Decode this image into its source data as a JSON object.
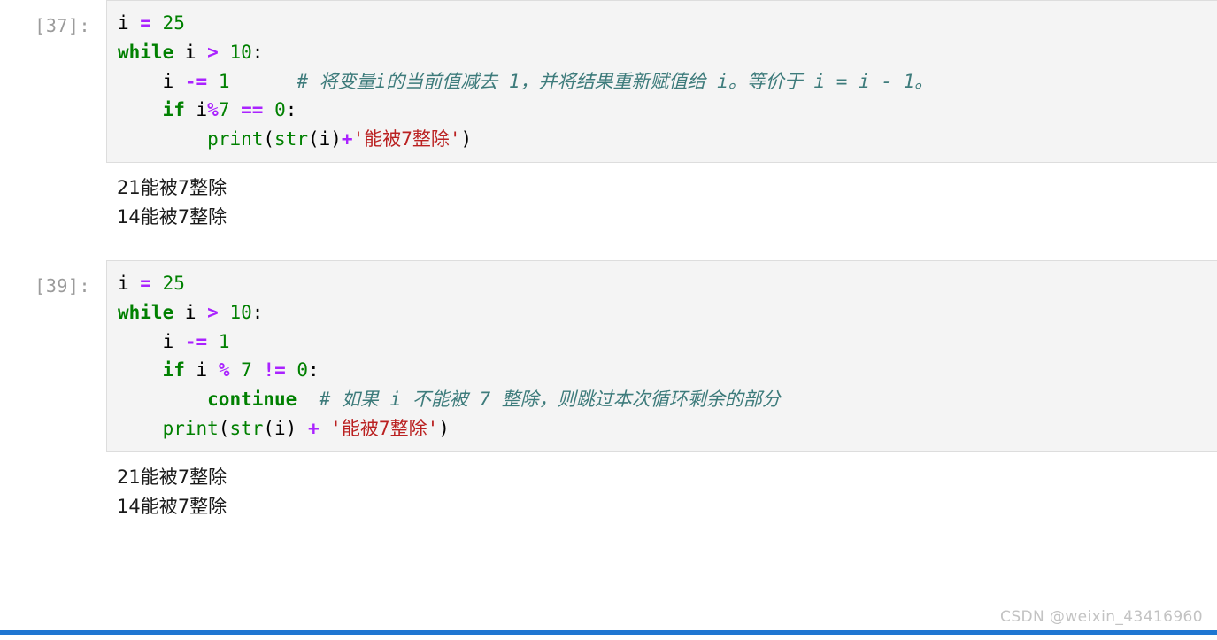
{
  "notebook": {
    "cells": [
      {
        "prompt": "[37]:",
        "code_lines": [
          {
            "tokens": [
              {
                "t": "i ",
                "c": "name"
              },
              {
                "t": "=",
                "c": "op"
              },
              {
                "t": " ",
                "c": "punct"
              },
              {
                "t": "25",
                "c": "num"
              }
            ]
          },
          {
            "tokens": [
              {
                "t": "while",
                "c": "kw"
              },
              {
                "t": " i ",
                "c": "name"
              },
              {
                "t": ">",
                "c": "op"
              },
              {
                "t": " ",
                "c": "punct"
              },
              {
                "t": "10",
                "c": "num"
              },
              {
                "t": ":",
                "c": "punct"
              }
            ]
          },
          {
            "tokens": [
              {
                "t": "    i ",
                "c": "name"
              },
              {
                "t": "-=",
                "c": "op"
              },
              {
                "t": " ",
                "c": "punct"
              },
              {
                "t": "1",
                "c": "num"
              },
              {
                "t": "      ",
                "c": "punct"
              },
              {
                "t": "# 将变量i的当前值减去 1，并将结果重新赋值给 i。等价于 i = i - 1。",
                "c": "comment"
              }
            ]
          },
          {
            "tokens": [
              {
                "t": "    ",
                "c": "punct"
              },
              {
                "t": "if",
                "c": "kw"
              },
              {
                "t": " i",
                "c": "name"
              },
              {
                "t": "%",
                "c": "op"
              },
              {
                "t": "7",
                "c": "num"
              },
              {
                "t": " ",
                "c": "punct"
              },
              {
                "t": "==",
                "c": "op"
              },
              {
                "t": " ",
                "c": "punct"
              },
              {
                "t": "0",
                "c": "num"
              },
              {
                "t": ":",
                "c": "punct"
              }
            ]
          },
          {
            "tokens": [
              {
                "t": "        ",
                "c": "punct"
              },
              {
                "t": "print",
                "c": "builtin"
              },
              {
                "t": "(",
                "c": "punct"
              },
              {
                "t": "str",
                "c": "builtin"
              },
              {
                "t": "(i)",
                "c": "punct"
              },
              {
                "t": "+",
                "c": "op"
              },
              {
                "t": "'能被7整除'",
                "c": "str"
              },
              {
                "t": ")",
                "c": "punct"
              }
            ]
          }
        ],
        "output_lines": [
          "21能被7整除",
          "14能被7整除"
        ]
      },
      {
        "prompt": "[39]:",
        "code_lines": [
          {
            "tokens": [
              {
                "t": "i ",
                "c": "name"
              },
              {
                "t": "=",
                "c": "op"
              },
              {
                "t": " ",
                "c": "punct"
              },
              {
                "t": "25",
                "c": "num"
              }
            ]
          },
          {
            "tokens": [
              {
                "t": "while",
                "c": "kw"
              },
              {
                "t": " i ",
                "c": "name"
              },
              {
                "t": ">",
                "c": "op"
              },
              {
                "t": " ",
                "c": "punct"
              },
              {
                "t": "10",
                "c": "num"
              },
              {
                "t": ":",
                "c": "punct"
              }
            ]
          },
          {
            "tokens": [
              {
                "t": "    i ",
                "c": "name"
              },
              {
                "t": "-=",
                "c": "op"
              },
              {
                "t": " ",
                "c": "punct"
              },
              {
                "t": "1",
                "c": "num"
              }
            ]
          },
          {
            "tokens": [
              {
                "t": "    ",
                "c": "punct"
              },
              {
                "t": "if",
                "c": "kw"
              },
              {
                "t": " i ",
                "c": "name"
              },
              {
                "t": "%",
                "c": "op"
              },
              {
                "t": " ",
                "c": "punct"
              },
              {
                "t": "7",
                "c": "num"
              },
              {
                "t": " ",
                "c": "punct"
              },
              {
                "t": "!=",
                "c": "op"
              },
              {
                "t": " ",
                "c": "punct"
              },
              {
                "t": "0",
                "c": "num"
              },
              {
                "t": ":",
                "c": "punct"
              }
            ]
          },
          {
            "tokens": [
              {
                "t": "        ",
                "c": "punct"
              },
              {
                "t": "continue",
                "c": "kw"
              },
              {
                "t": "  ",
                "c": "punct"
              },
              {
                "t": "# 如果 i 不能被 7 整除，则跳过本次循环剩余的部分",
                "c": "comment"
              }
            ]
          },
          {
            "tokens": [
              {
                "t": "    ",
                "c": "punct"
              },
              {
                "t": "print",
                "c": "builtin"
              },
              {
                "t": "(",
                "c": "punct"
              },
              {
                "t": "str",
                "c": "builtin"
              },
              {
                "t": "(i) ",
                "c": "punct"
              },
              {
                "t": "+",
                "c": "op"
              },
              {
                "t": " ",
                "c": "punct"
              },
              {
                "t": "'能被7整除'",
                "c": "str"
              },
              {
                "t": ")",
                "c": "punct"
              }
            ]
          }
        ],
        "output_lines": [
          "21能被7整除",
          "14能被7整除"
        ]
      }
    ]
  },
  "watermark": {
    "text": "CSDN @weixin_43416960"
  },
  "colors": {
    "keyword": "#008000",
    "operator": "#aa22ff",
    "string": "#ba2121",
    "comment": "#3d7b7b",
    "cell_background": "#f4f4f4",
    "prompt": "#9b9b9b",
    "accent_bar": "#1f76d2"
  }
}
